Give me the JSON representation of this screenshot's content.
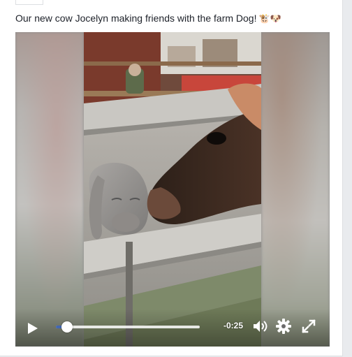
{
  "post": {
    "text": "Our new cow Jocelyn making friends with the farm Dog!",
    "emojis": "🐮🐶"
  },
  "video": {
    "progress": 0.08,
    "time_remaining": "-0:25",
    "play_icon": "play-icon",
    "volume_icon": "volume-icon",
    "settings_icon": "gear-icon",
    "fullscreen_icon": "fullscreen-icon"
  },
  "colors": {
    "text": "#1d2129",
    "progress_fill": "#4267b2",
    "card_border": "#dddfe2"
  }
}
